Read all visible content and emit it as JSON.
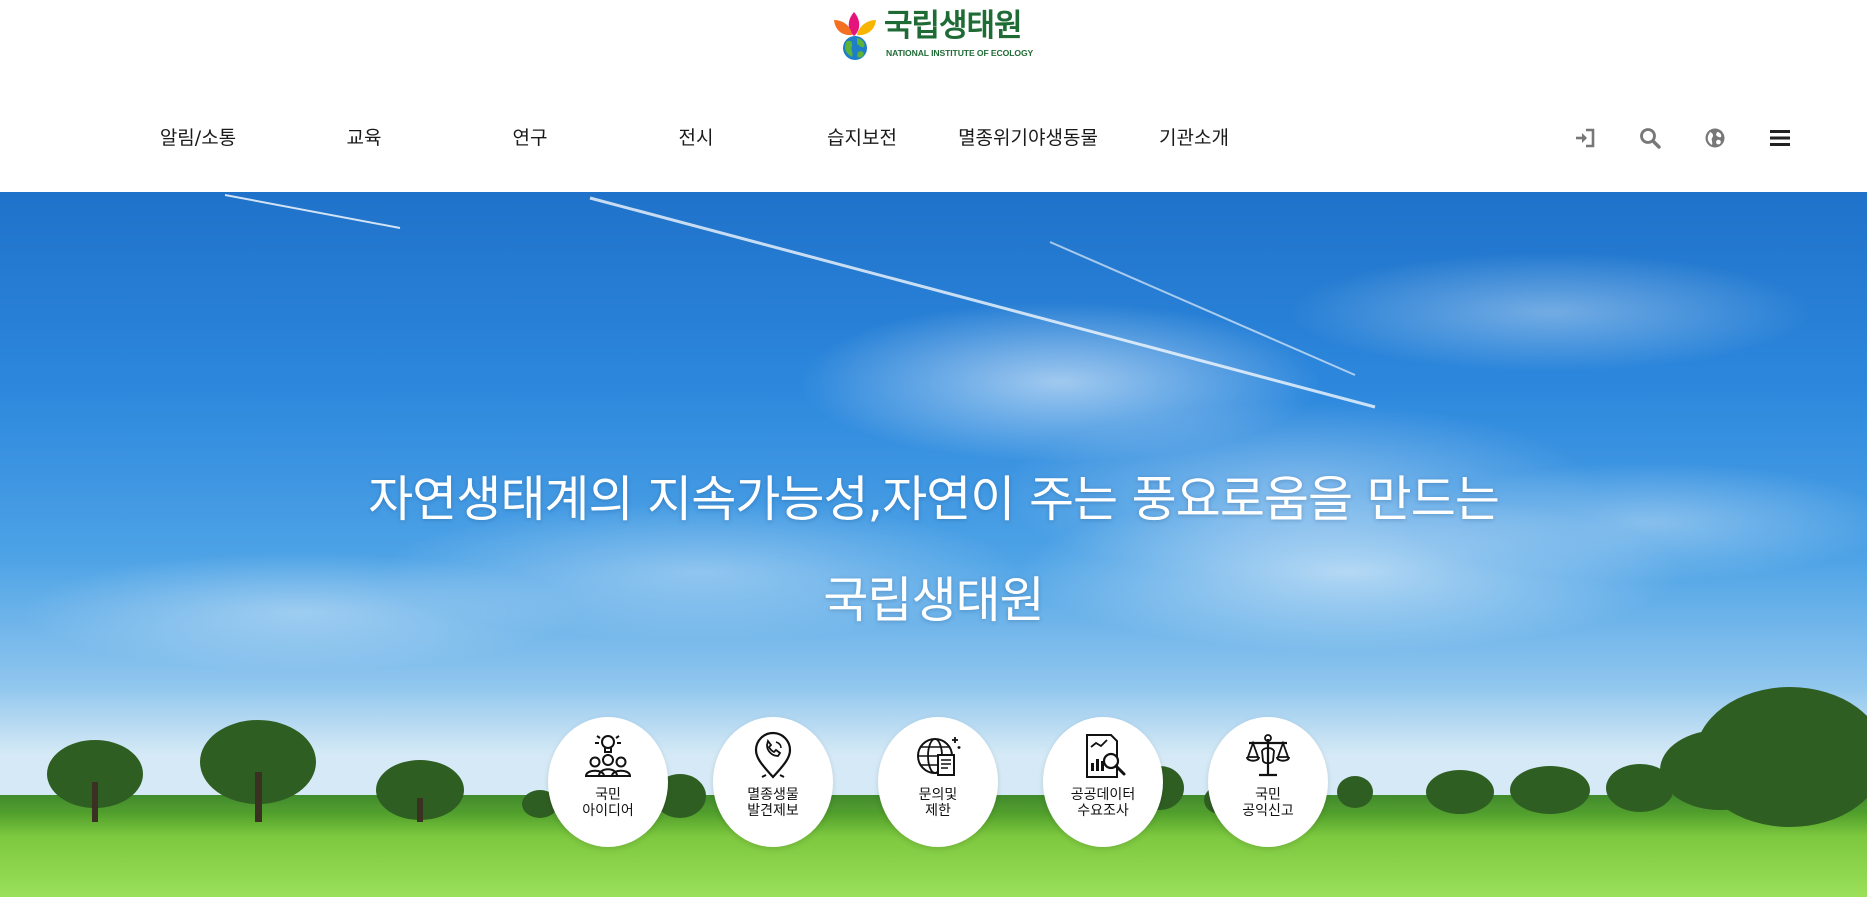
{
  "header": {
    "logo": {
      "title": "국립생태원",
      "subtitle": "NATIONAL INSTITUTE OF ECOLOGY"
    },
    "nav": [
      {
        "label": "알림/소통"
      },
      {
        "label": "교육"
      },
      {
        "label": "연구"
      },
      {
        "label": "전시"
      },
      {
        "label": "습지보전"
      },
      {
        "label": "멸종위기야생동물"
      },
      {
        "label": "기관소개"
      }
    ],
    "utility_icons": [
      "login-icon",
      "search-icon",
      "globe-icon",
      "menu-icon"
    ]
  },
  "hero": {
    "slogan_line1": "자연생태계의 지속가능성,자연이 주는 풍요로움을 만드는",
    "slogan_line2": "국립생태원"
  },
  "quick_menu": [
    {
      "label": "국민\n아이디어",
      "icon": "people-idea-icon"
    },
    {
      "label": "멸종생물\n발견제보",
      "icon": "location-phone-icon"
    },
    {
      "label": "문의및\n제한",
      "icon": "globe-document-icon"
    },
    {
      "label": "공공데이터\n수요조사",
      "icon": "data-search-icon"
    },
    {
      "label": "국민\n공익신고",
      "icon": "justice-scale-icon"
    }
  ],
  "colors": {
    "logo_green": "#1f6b35",
    "nav_text": "#1a1a1a",
    "sky_top": "#1f72c9",
    "grass": "#7cc83e",
    "icon_gray": "#777777"
  }
}
